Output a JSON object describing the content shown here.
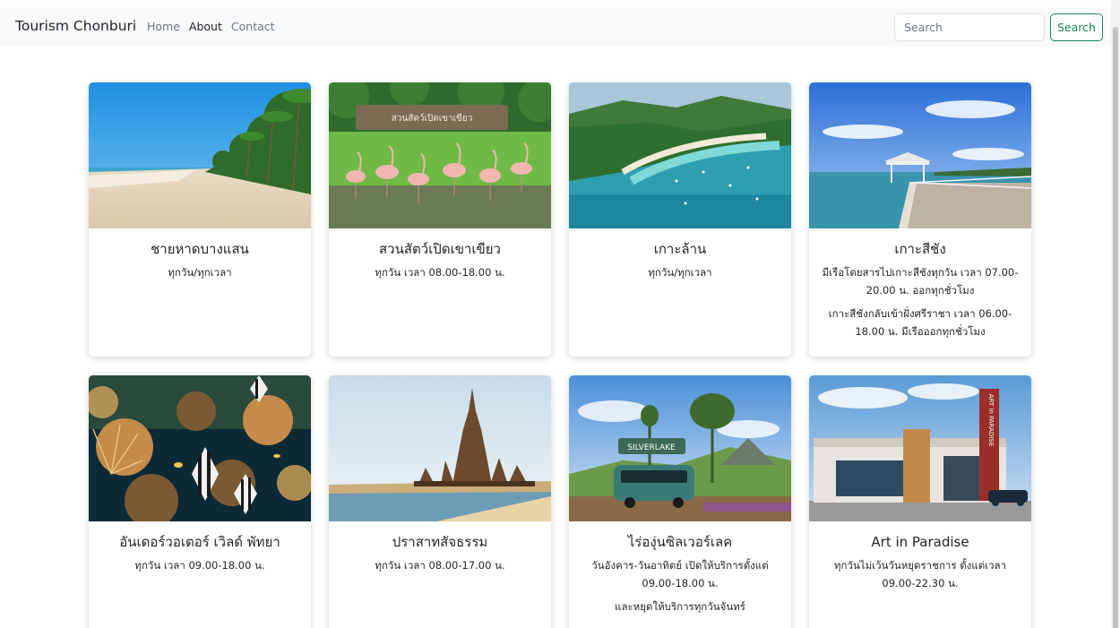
{
  "navbar": {
    "brand": "Tourism Chonburi",
    "links": [
      "Home",
      "About",
      "Contact"
    ],
    "search_placeholder": "Search",
    "search_button": "Search"
  },
  "cards": [
    {
      "title": "ชายหาดบางแสน",
      "lines": [
        "ทุกวัน/ทุกเวลา"
      ]
    },
    {
      "title": "สวนสัตว์เปิดเขาเขียว",
      "lines": [
        "ทุกวัน เวลา 08.00-18.00 น."
      ]
    },
    {
      "title": "เกาะล้าน",
      "lines": [
        "ทุกวัน/ทุกเวลา"
      ]
    },
    {
      "title": "เกาะสีชัง",
      "lines": [
        "มีเรือโดยสารไปเกาะสีชังทุกวัน เวลา 07.00-20.00 น. ออกทุกชั่วโมง",
        "เกาะสีชังกลับเข้าฝั่งศรีราชา เวลา 06.00-18.00 น. มีเรือออกทุกชั่วโมง"
      ]
    },
    {
      "title": "อันเดอร์วอเตอร์ เวิลด์ พัทยา",
      "lines": [
        "ทุกวัน เวลา 09.00-18.00 น."
      ]
    },
    {
      "title": "ปราสาทสัจธรรม",
      "lines": [
        "ทุกวัน เวลา 08.00-17.00 น."
      ]
    },
    {
      "title": "ไร่องุ่นซิลเวอร์เลค",
      "lines": [
        "วันอังคาร-วันอาทิตย์ เปิดให้บริการตั้งแต่ 09.00-18.00 น.",
        "และหยุดให้บริการทุกวันจันทร์"
      ]
    },
    {
      "title": "Art in Paradise",
      "lines": [
        "ทุกวันไม่เว้นวันหยุดราชการ ตั้งแต่เวลา 09.00-22.30 น."
      ]
    }
  ],
  "photo_signs": {
    "zoo": "สวนสัตว์เปิดเขาเขียว",
    "vineyard": "SILVERLAKE",
    "art": "ART in PARADISE"
  }
}
